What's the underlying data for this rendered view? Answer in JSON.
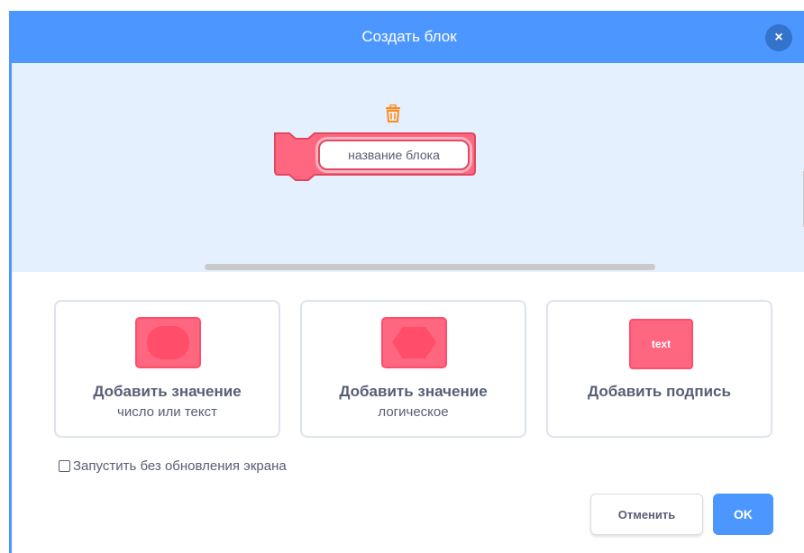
{
  "header": {
    "title": "Создать блок",
    "close_label": "×"
  },
  "preview": {
    "block_name": "название блока",
    "block_color": "#ff6680",
    "block_border_color": "#e0475f",
    "trash_icon": "trash-icon"
  },
  "options": [
    {
      "title": "Добавить значение",
      "subtitle": "число или текст",
      "icon": "rounded-input-icon"
    },
    {
      "title": "Добавить значение",
      "subtitle": "логическое",
      "icon": "boolean-input-icon"
    },
    {
      "title": "Добавить подпись",
      "subtitle": "",
      "icon": "label-icon",
      "icon_text": "text"
    }
  ],
  "checkbox": {
    "label": "Запустить без обновления экрана",
    "checked": false
  },
  "buttons": {
    "cancel": "Отменить",
    "ok": "OK"
  },
  "colors": {
    "accent": "#4c97ff",
    "accent_dark": "#3373cc",
    "preview_bg": "#e5f0ff",
    "block_pink": "#ff6680",
    "text": "#575e75",
    "trash": "#ff8c1a"
  }
}
